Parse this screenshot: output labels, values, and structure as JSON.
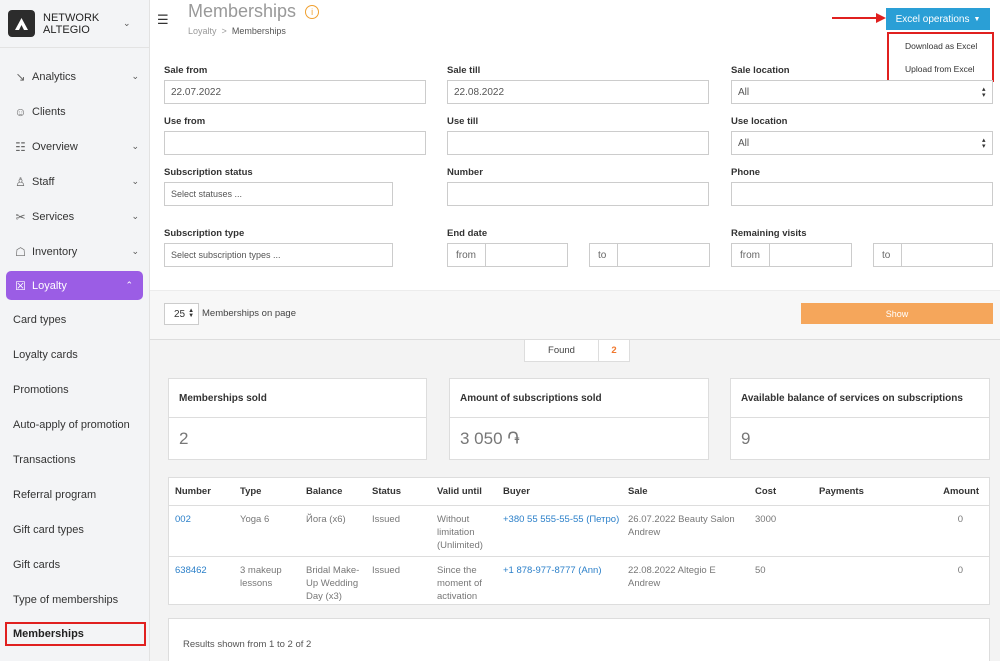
{
  "app": {
    "network_name": "NETWORK ALTEGIO",
    "colors": {
      "accent": "#2a9fd6",
      "loyalty": "#9b5de5",
      "highlight": "#e0201f",
      "show_button": "#f5a65b",
      "found_value": "#f0782d"
    }
  },
  "sidebar": {
    "items": [
      {
        "label": "Analytics",
        "icon": "analytics-icon"
      },
      {
        "label": "Clients",
        "icon": "clients-icon"
      },
      {
        "label": "Overview",
        "icon": "overview-icon"
      },
      {
        "label": "Staff",
        "icon": "staff-icon"
      },
      {
        "label": "Services",
        "icon": "services-icon"
      },
      {
        "label": "Inventory",
        "icon": "inventory-icon"
      }
    ],
    "active": {
      "label": "Loyalty",
      "icon": "loyalty-icon"
    },
    "sub_items": [
      "Card types",
      "Loyalty cards",
      "Promotions",
      "Auto-apply of promotion",
      "Transactions",
      "Referral program",
      "Gift card types",
      "Gift cards",
      "Type of memberships",
      "Memberships"
    ]
  },
  "header": {
    "title": "Memberships",
    "breadcrumb": {
      "parent": "Loyalty",
      "separator": ">",
      "current": "Memberships"
    },
    "excel_button": "Excel operations",
    "excel_menu": [
      "Download as Excel",
      "Upload from Excel"
    ]
  },
  "filters": {
    "sale_from": {
      "label": "Sale from",
      "value": "22.07.2022"
    },
    "sale_till": {
      "label": "Sale till",
      "value": "22.08.2022"
    },
    "sale_location": {
      "label": "Sale location",
      "value": "All"
    },
    "use_from": {
      "label": "Use from",
      "value": ""
    },
    "use_till": {
      "label": "Use till",
      "value": ""
    },
    "use_location": {
      "label": "Use location",
      "value": "All"
    },
    "subscription_status": {
      "label": "Subscription status",
      "placeholder": "Select statuses ..."
    },
    "number": {
      "label": "Number",
      "value": ""
    },
    "phone": {
      "label": "Phone",
      "value": ""
    },
    "subscription_type": {
      "label": "Subscription type",
      "placeholder": "Select subscription types ..."
    },
    "end_date": {
      "label": "End date",
      "from": "from",
      "to": "to"
    },
    "remaining_visits": {
      "label": "Remaining visits",
      "from": "from",
      "to": "to"
    }
  },
  "pager": {
    "page_size": "25",
    "page_size_label": "Memberships on page",
    "show_button": "Show"
  },
  "found": {
    "label": "Found",
    "value": "2"
  },
  "stats": [
    {
      "title": "Memberships sold",
      "value": "2"
    },
    {
      "title": "Amount of subscriptions sold",
      "value": "3 050 ֏"
    },
    {
      "title": "Available balance of services on subscriptions",
      "value": "9"
    }
  ],
  "table": {
    "columns": [
      "Number",
      "Type",
      "Balance",
      "Status",
      "Valid until",
      "Buyer",
      "Sale",
      "Cost",
      "Payments",
      "Amount"
    ],
    "rows": [
      {
        "number": "002",
        "type": "Yoga 6",
        "balance": "Йога (x6)",
        "status": "Issued",
        "valid_until": "Without limitation (Unlimited)",
        "buyer": "+380 55 555-55-55 (Петро)",
        "sale": "26.07.2022 Beauty Salon Andrew",
        "cost": "3000",
        "payments": "",
        "amount": "0"
      },
      {
        "number": "638462",
        "type": "3 makeup lessons",
        "balance": "Bridal Make-Up Wedding Day (x3)",
        "status": "Issued",
        "valid_until": "Since the moment of activation",
        "buyer": "+1 878-977-8777 (Ann)",
        "sale": "22.08.2022 Altegio E Andrew",
        "cost": "50",
        "payments": "",
        "amount": "0"
      }
    ]
  },
  "results": "Results shown from 1 to 2 of 2"
}
